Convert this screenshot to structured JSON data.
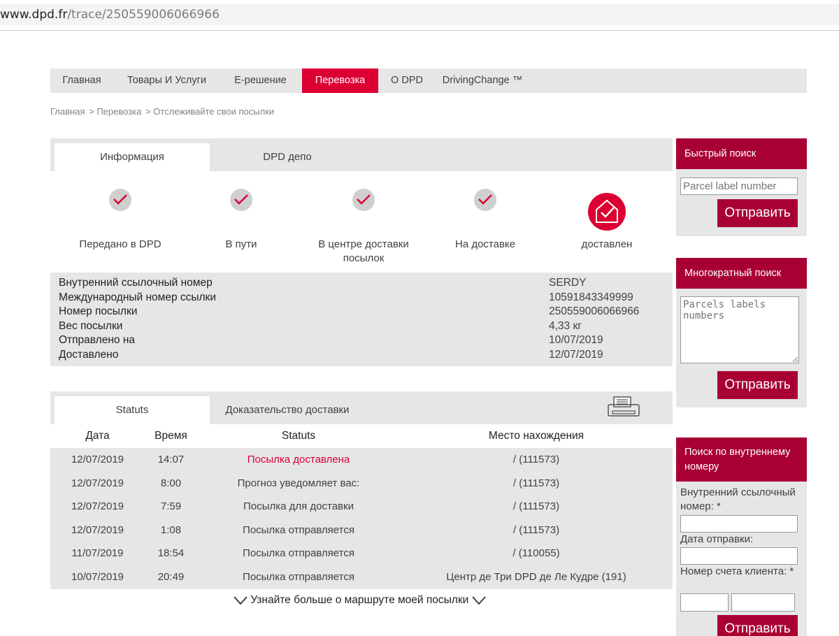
{
  "browser": {
    "url_host": "www.dpd.fr",
    "url_path": "/trace/250559006066966"
  },
  "nav": {
    "items": [
      {
        "label": "Главная",
        "active": false
      },
      {
        "label": "Товары И Услуги",
        "active": false
      },
      {
        "label": "E-решение",
        "active": false
      },
      {
        "label": "Перевозка",
        "active": true
      },
      {
        "label": "О DPD",
        "active": false
      },
      {
        "label": "DrivingChange ™",
        "active": false
      }
    ]
  },
  "breadcrumb": {
    "items": [
      "Главная",
      "> Перевозка",
      "> Отслеживайте свои посылки"
    ]
  },
  "info_tabs": {
    "tabs": [
      "Информация",
      "DPD депо"
    ]
  },
  "steps": [
    {
      "label": "Передано в DPD",
      "done": true
    },
    {
      "label": "В пути",
      "done": true
    },
    {
      "label": "В центре доставки посылок",
      "done": true
    },
    {
      "label": "На доставке",
      "done": true
    },
    {
      "label": "доставлен",
      "current": true
    }
  ],
  "parcel_info": {
    "rows": [
      {
        "key": "Внутренний ссылочный номер",
        "value": "SERDY"
      },
      {
        "key": "Международный номер ссылки",
        "value": "10591843349999"
      },
      {
        "key": "Номер посылки",
        "value": "250559006066966"
      },
      {
        "key": "Вес посылки",
        "value": "4,33 кг"
      },
      {
        "key": "Отправлено на",
        "value": "10/07/2019"
      },
      {
        "key": "Доставлено",
        "value": "12/07/2019"
      }
    ]
  },
  "status_tabs": {
    "tabs": [
      "Statuts",
      "Доказательство доставки"
    ],
    "print_icon": "printer-icon"
  },
  "events": {
    "headers": {
      "date": "Дата",
      "time": "Время",
      "status": "Statuts",
      "place": "Место нахождения"
    },
    "rows": [
      {
        "date": "12/07/2019",
        "time": "14:07",
        "status": "Посылка доставлена",
        "place": "/ (111573)"
      },
      {
        "date": "12/07/2019",
        "time": "8:00",
        "status": "Прогноз уведомляет вас:",
        "place": "/ (111573)"
      },
      {
        "date": "12/07/2019",
        "time": "7:59",
        "status": "Посылка для доставки",
        "place": "/ (111573)"
      },
      {
        "date": "12/07/2019",
        "time": "1:08",
        "status": "Посылка отправляется",
        "place": "/ (111573)"
      },
      {
        "date": "11/07/2019",
        "time": "18:54",
        "status": "Посылка отправляется",
        "place": "/ (110055)"
      },
      {
        "date": "10/07/2019",
        "time": "20:49",
        "status": "Посылка отправляется",
        "place": "Центр де Три DPD де Ле Кудре (191)"
      }
    ],
    "more_label": "Узнайте больше о маршруте моей посылки"
  },
  "sidebar": {
    "quick_search": {
      "title": "Быстрый поиск",
      "placeholder": "Parcel label number",
      "button": "Отправить"
    },
    "multi_search": {
      "title": "Многократный поиск",
      "placeholder": "Parcels labels numbers",
      "button": "Отправить"
    },
    "ref_search": {
      "title": "Поиск по внутреннему номеру",
      "ref_label": "Внутренний ссылочный номер: *",
      "date_label": "Дата отправки:",
      "account_label": "Номер счета клиента: *",
      "button": "Отправить"
    }
  },
  "colors": {
    "brand_red": "#dc0032",
    "side_red": "#a90034",
    "panel_gray": "#e6e6e7"
  }
}
